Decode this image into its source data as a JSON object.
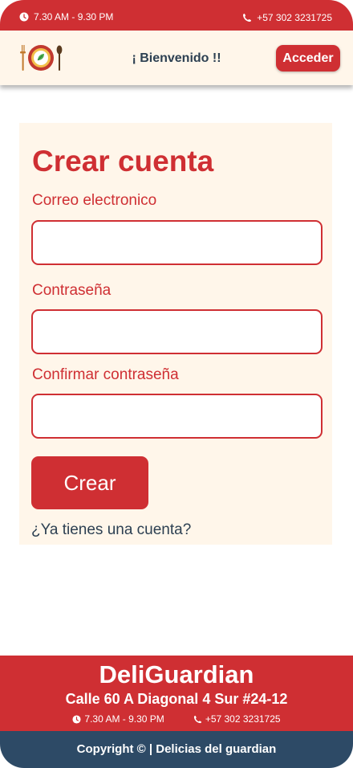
{
  "topbar": {
    "hours": "7.30 AM - 9.30 PM",
    "phone": "+57 302 3231725"
  },
  "header": {
    "welcome": "¡ Bienvenido !!",
    "login_button": "Acceder"
  },
  "form": {
    "title": "Crear cuenta",
    "email_label": "Correo electronico",
    "email_value": "",
    "password_label": "Contraseña",
    "password_value": "",
    "confirm_label": "Confirmar contraseña",
    "confirm_value": "",
    "submit_label": "Crear",
    "login_link": "¿Ya tienes una cuenta?"
  },
  "footer": {
    "brand": "DeliGuardian",
    "address": "Calle 60 A Diagonal 4 Sur #24-12",
    "hours": "7.30 AM - 9.30 PM",
    "phone": "+57 302 3231725",
    "copyright": "Copyright ©  | Delicias del guardian"
  },
  "colors": {
    "primary_red": "#cf2f33",
    "cream": "#fff6ea",
    "navy": "#2d4a66",
    "text_dark": "#2d4052"
  },
  "icons": [
    "clock-icon",
    "phone-icon",
    "logo-fork-plate-spoon"
  ]
}
